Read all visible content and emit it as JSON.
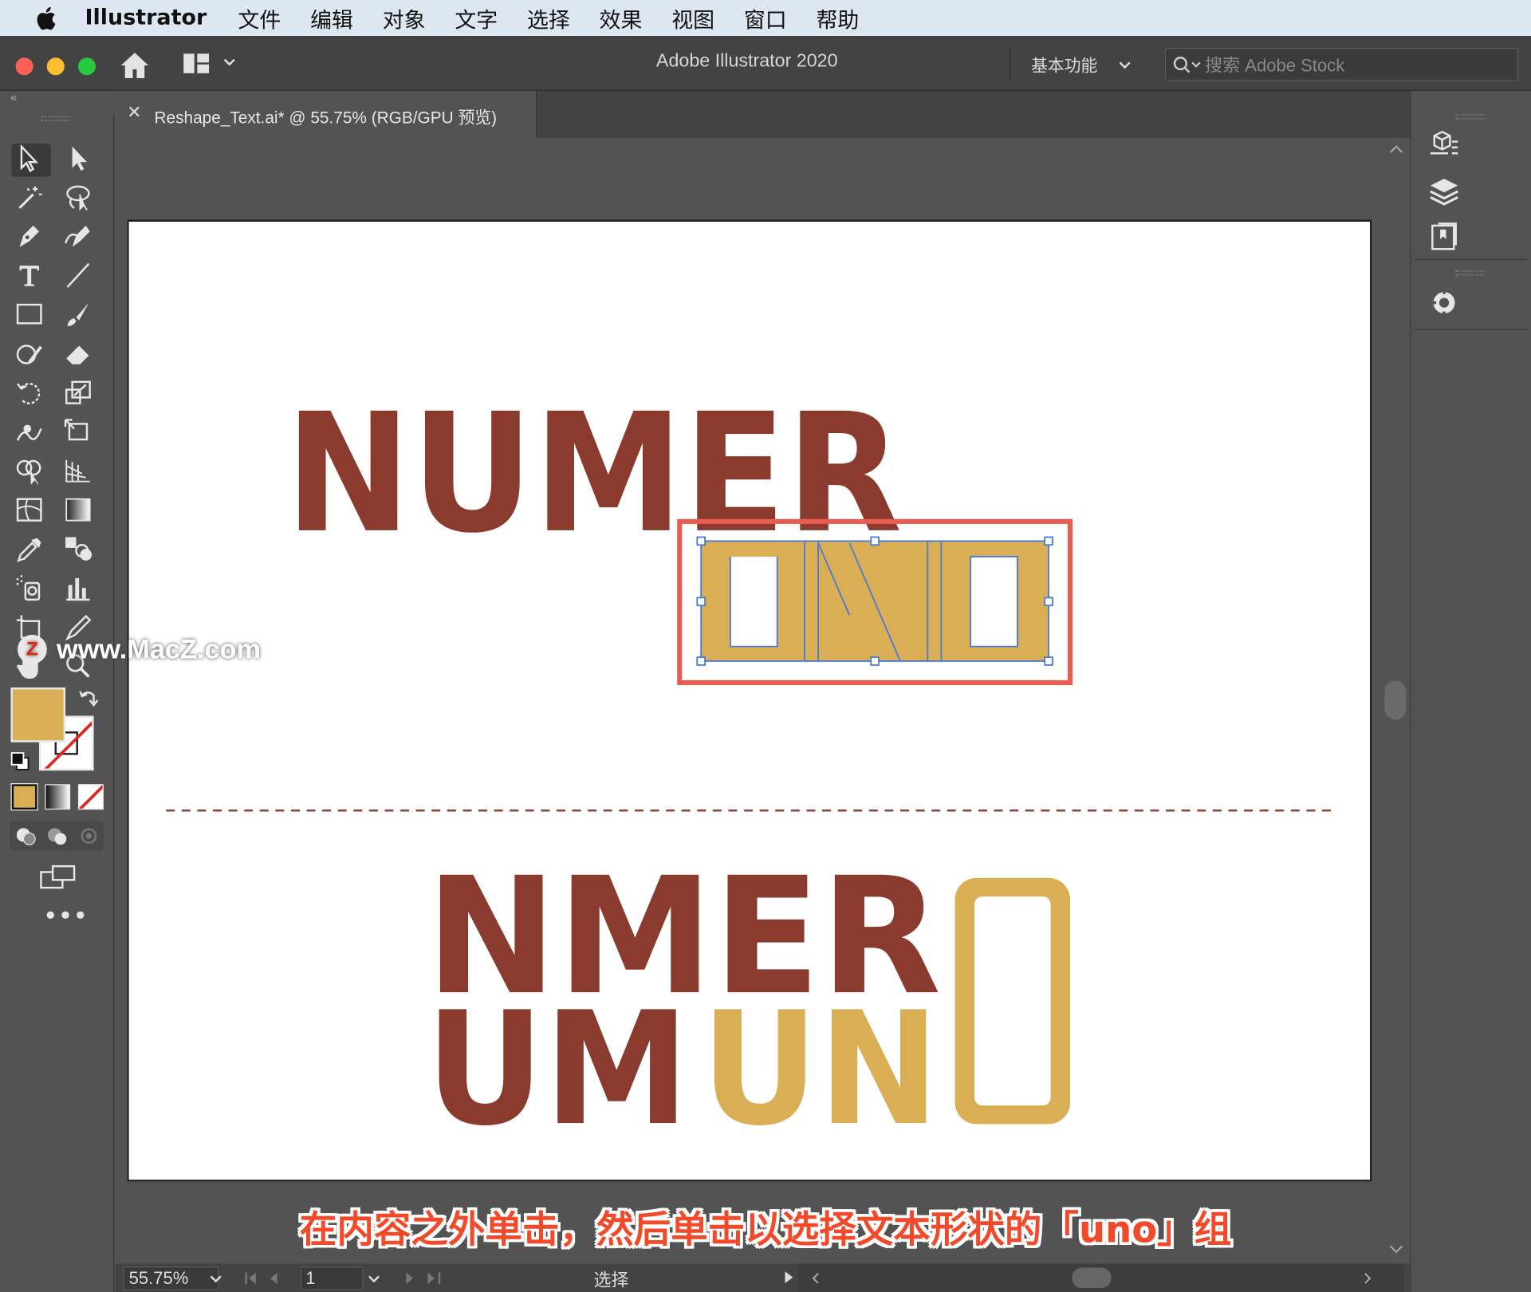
{
  "menubar": {
    "app": "Illustrator",
    "items": [
      "文件",
      "编辑",
      "对象",
      "文字",
      "选择",
      "效果",
      "视图",
      "窗口",
      "帮助"
    ]
  },
  "appbar": {
    "title": "Adobe Illustrator 2020",
    "workspace": "基本功能",
    "search_placeholder": "搜索 Adobe Stock"
  },
  "document": {
    "tab_title": "Reshape_Text.ai* @ 55.75% (RGB/GPU 预览)"
  },
  "artwork": {
    "top_word": "NUMER",
    "selected_word": "UNO",
    "bottom_line1": "NMER",
    "bottom_line2_dark": "UM",
    "bottom_line2_gold": "UN",
    "bottom_o": "O",
    "colors": {
      "dark_red": "#8b3a2e",
      "gold": "#d9ae55",
      "selection": "#4b7bd6",
      "highlight": "#ea5b50"
    }
  },
  "status": {
    "zoom": "55.75%",
    "page": "1",
    "mode": "选择"
  },
  "watermark": "www.MacZ.com",
  "caption": "在内容之外单击，然后单击以选择文本形状的「uno」组",
  "fill_color": "#d9ae55"
}
